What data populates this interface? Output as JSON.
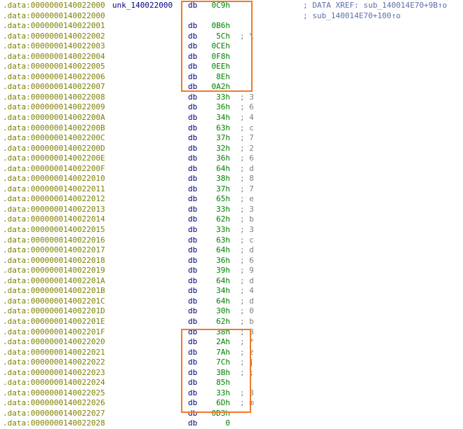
{
  "listing": {
    "rows": [
      {
        "addr": ".data:0000000140022000",
        "label": "unk_140022000",
        "op": "db",
        "val": "0C9h",
        "cmt": "",
        "xref": "; DATA XREF: sub_140014E70+9B↑o"
      },
      {
        "addr": ".data:0000000140022000",
        "label": "",
        "op": "",
        "val": "",
        "cmt": "",
        "xref": "; sub_140014E70+100↑o"
      },
      {
        "addr": ".data:0000000140022001",
        "label": "",
        "op": "db",
        "val": "0B6h",
        "cmt": "",
        "xref": ""
      },
      {
        "addr": ".data:0000000140022002",
        "label": "",
        "op": "db",
        "val": "5Ch",
        "cmt": "; \\",
        "xref": ""
      },
      {
        "addr": ".data:0000000140022003",
        "label": "",
        "op": "db",
        "val": "0CEh",
        "cmt": "",
        "xref": ""
      },
      {
        "addr": ".data:0000000140022004",
        "label": "",
        "op": "db",
        "val": "0F8h",
        "cmt": "",
        "xref": ""
      },
      {
        "addr": ".data:0000000140022005",
        "label": "",
        "op": "db",
        "val": "0EEh",
        "cmt": "",
        "xref": ""
      },
      {
        "addr": ".data:0000000140022006",
        "label": "",
        "op": "db",
        "val": "8Eh",
        "cmt": "",
        "xref": ""
      },
      {
        "addr": ".data:0000000140022007",
        "label": "",
        "op": "db",
        "val": "0A2h",
        "cmt": "",
        "xref": ""
      },
      {
        "addr": ".data:0000000140022008",
        "label": "",
        "op": "db",
        "val": "33h",
        "cmt": "; 3",
        "xref": ""
      },
      {
        "addr": ".data:0000000140022009",
        "label": "",
        "op": "db",
        "val": "36h",
        "cmt": "; 6",
        "xref": ""
      },
      {
        "addr": ".data:000000014002200A",
        "label": "",
        "op": "db",
        "val": "34h",
        "cmt": "; 4",
        "xref": ""
      },
      {
        "addr": ".data:000000014002200B",
        "label": "",
        "op": "db",
        "val": "63h",
        "cmt": "; c",
        "xref": ""
      },
      {
        "addr": ".data:000000014002200C",
        "label": "",
        "op": "db",
        "val": "37h",
        "cmt": "; 7",
        "xref": ""
      },
      {
        "addr": ".data:000000014002200D",
        "label": "",
        "op": "db",
        "val": "32h",
        "cmt": "; 2",
        "xref": ""
      },
      {
        "addr": ".data:000000014002200E",
        "label": "",
        "op": "db",
        "val": "36h",
        "cmt": "; 6",
        "xref": ""
      },
      {
        "addr": ".data:000000014002200F",
        "label": "",
        "op": "db",
        "val": "64h",
        "cmt": "; d",
        "xref": ""
      },
      {
        "addr": ".data:0000000140022010",
        "label": "",
        "op": "db",
        "val": "38h",
        "cmt": "; 8",
        "xref": ""
      },
      {
        "addr": ".data:0000000140022011",
        "label": "",
        "op": "db",
        "val": "37h",
        "cmt": "; 7",
        "xref": ""
      },
      {
        "addr": ".data:0000000140022012",
        "label": "",
        "op": "db",
        "val": "65h",
        "cmt": "; e",
        "xref": ""
      },
      {
        "addr": ".data:0000000140022013",
        "label": "",
        "op": "db",
        "val": "33h",
        "cmt": "; 3",
        "xref": ""
      },
      {
        "addr": ".data:0000000140022014",
        "label": "",
        "op": "db",
        "val": "62h",
        "cmt": "; b",
        "xref": ""
      },
      {
        "addr": ".data:0000000140022015",
        "label": "",
        "op": "db",
        "val": "33h",
        "cmt": "; 3",
        "xref": ""
      },
      {
        "addr": ".data:0000000140022016",
        "label": "",
        "op": "db",
        "val": "63h",
        "cmt": "; c",
        "xref": ""
      },
      {
        "addr": ".data:0000000140022017",
        "label": "",
        "op": "db",
        "val": "64h",
        "cmt": "; d",
        "xref": ""
      },
      {
        "addr": ".data:0000000140022018",
        "label": "",
        "op": "db",
        "val": "36h",
        "cmt": "; 6",
        "xref": ""
      },
      {
        "addr": ".data:0000000140022019",
        "label": "",
        "op": "db",
        "val": "39h",
        "cmt": "; 9",
        "xref": ""
      },
      {
        "addr": ".data:000000014002201A",
        "label": "",
        "op": "db",
        "val": "64h",
        "cmt": "; d",
        "xref": ""
      },
      {
        "addr": ".data:000000014002201B",
        "label": "",
        "op": "db",
        "val": "34h",
        "cmt": "; 4",
        "xref": ""
      },
      {
        "addr": ".data:000000014002201C",
        "label": "",
        "op": "db",
        "val": "64h",
        "cmt": "; d",
        "xref": ""
      },
      {
        "addr": ".data:000000014002201D",
        "label": "",
        "op": "db",
        "val": "30h",
        "cmt": "; 0",
        "xref": ""
      },
      {
        "addr": ".data:000000014002201E",
        "label": "",
        "op": "db",
        "val": "62h",
        "cmt": "; b",
        "xref": ""
      },
      {
        "addr": ".data:000000014002201F",
        "label": "",
        "op": "db",
        "val": "38h",
        "cmt": "; 8",
        "xref": ""
      },
      {
        "addr": ".data:0000000140022020",
        "label": "",
        "op": "db",
        "val": "2Ah",
        "cmt": "; *",
        "xref": ""
      },
      {
        "addr": ".data:0000000140022021",
        "label": "",
        "op": "db",
        "val": "7Ah",
        "cmt": "; z",
        "xref": ""
      },
      {
        "addr": ".data:0000000140022022",
        "label": "",
        "op": "db",
        "val": "7Ch",
        "cmt": "; |",
        "xref": ""
      },
      {
        "addr": ".data:0000000140022023",
        "label": "",
        "op": "db",
        "val": "3Bh",
        "cmt": "; ;",
        "xref": ""
      },
      {
        "addr": ".data:0000000140022024",
        "label": "",
        "op": "db",
        "val": "85h",
        "cmt": "",
        "xref": ""
      },
      {
        "addr": ".data:0000000140022025",
        "label": "",
        "op": "db",
        "val": "33h",
        "cmt": "; 3",
        "xref": ""
      },
      {
        "addr": ".data:0000000140022026",
        "label": "",
        "op": "db",
        "val": "6Dh",
        "cmt": "; m",
        "xref": ""
      },
      {
        "addr": ".data:0000000140022027",
        "label": "",
        "op": "db",
        "val": "0D3h",
        "cmt": "",
        "xref": ""
      },
      {
        "addr": ".data:0000000140022028",
        "label": "",
        "op": "db",
        "val": "0",
        "cmt": "",
        "xref": ""
      }
    ]
  },
  "colors": {
    "address": "#7f7f00",
    "label": "#000080",
    "mnemonic": "#000080",
    "value": "#008000",
    "comment": "#7f7f7f",
    "xref": "#5c6fa8",
    "highlight_box": "#f07a2a"
  }
}
